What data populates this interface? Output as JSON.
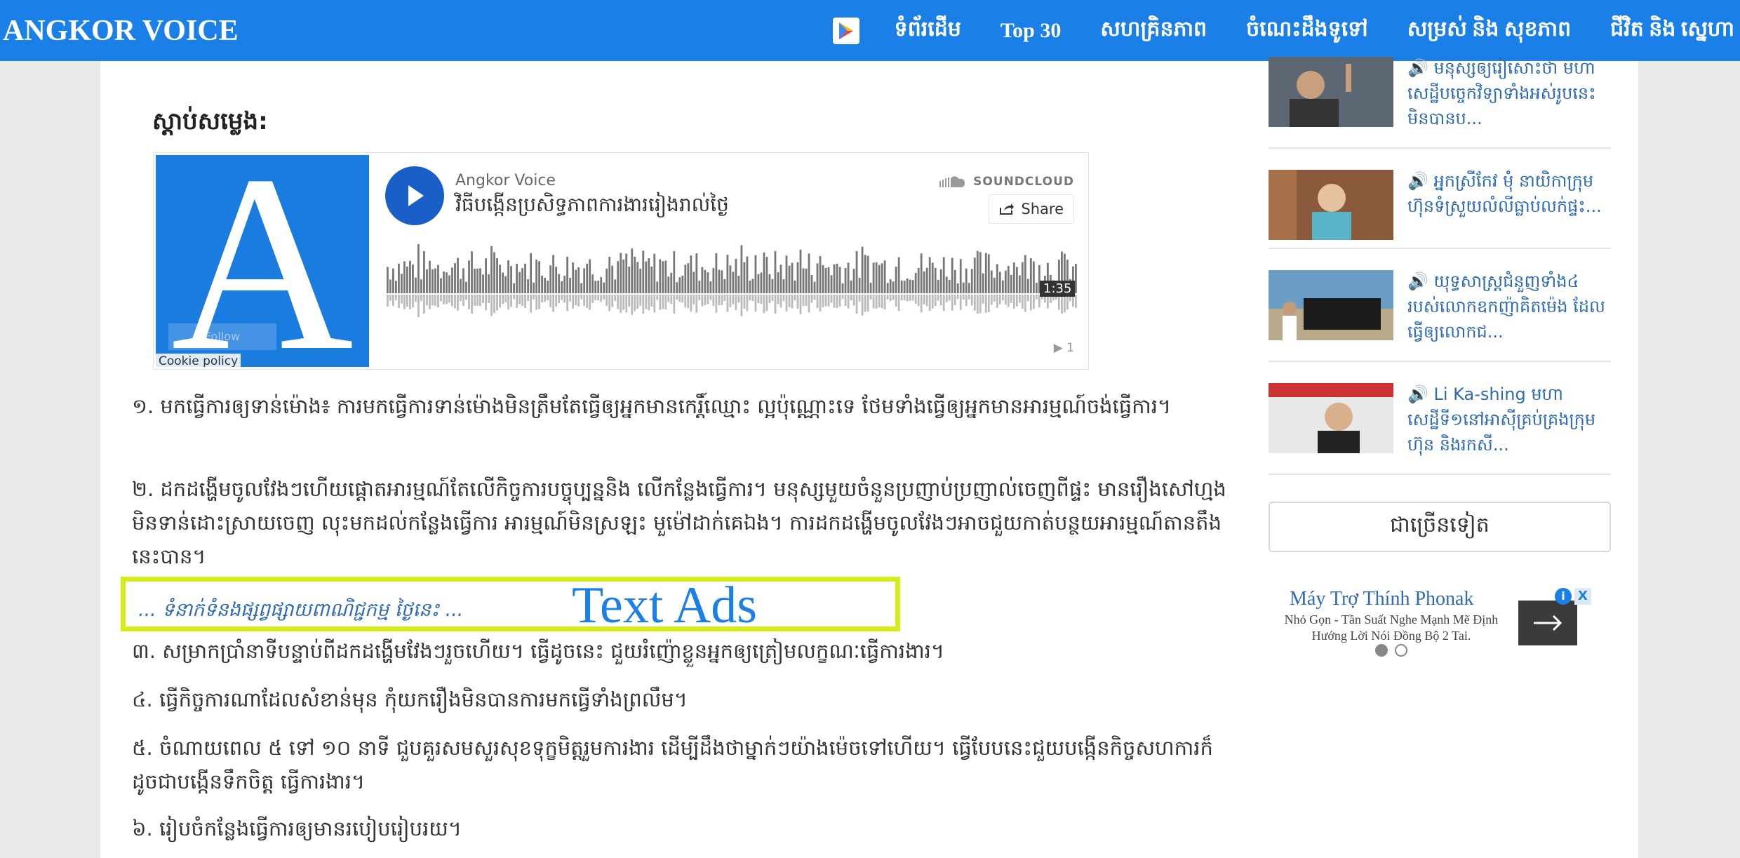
{
  "header": {
    "logo": "ANGKOR VOICE",
    "nav_items": [
      {
        "label": "ទំព័រដើម"
      },
      {
        "label": "Top 30"
      },
      {
        "label": "សហគ្រិនភាព"
      },
      {
        "label": "ចំណេះដឹងទូទៅ"
      },
      {
        "label": "សម្រស់ និង សុខភាព"
      },
      {
        "label": "ជីវិត និង ស្នេហា"
      }
    ],
    "play_store_icon": "google-play-icon"
  },
  "article": {
    "listen_label": "ស្តាប់សម្លេង:",
    "player": {
      "artist": "Angkor Voice",
      "track": "វិធីបង្កើនប្រសិទ្ធភាពការងាររៀងរាល់ថ្ងៃ",
      "brand": "SOUNDCLOUD",
      "share_label": "Share",
      "duration": "1:35",
      "plays": "1",
      "follow_label": "Follow",
      "cookie_label": "Cookie policy",
      "art_letter": "A"
    },
    "paragraphs": [
      "១. មកធ្វើការឲ្យទាន់ម៉ោង៖ ការមកធ្វើការទាន់ម៉ោងមិនត្រឹមតែធ្វើឲ្យអ្នកមានកេរ្តិ៍ឈ្មោះ ល្អប៉ុណ្ណោះទេ ថែមទាំងធ្វើឲ្យអ្នកមានអារម្មណ៍ចង់ធ្វើការ។",
      "២. ដកដង្ហើមចូលវែងៗហើយផ្តោតអារម្មណ៍តែលើកិច្ចការបច្ចុប្បន្ននិង លើកន្លែងធ្វើការ។ មនុស្សមួយចំនួនប្រញាប់ប្រញាល់ចេញពីផ្ទះ មានរឿងសៅហ្មងមិនទាន់ដោះស្រាយចេញ លុះមកដល់កន្លែងធ្វើការ អារម្មណ៍មិនស្រឡះ មួម៉ៅដាក់គេឯង។ ការដកដង្ហើមចូលវែងៗអាចជួយកាត់បន្ថយអារម្មណ៍តានតឹងនេះបាន។",
      "៣. សម្រាកប្រាំនាទីបន្ទាប់ពីដកដង្ហើមវែងៗរួចហើយ។ ធ្វើដូចនេះ ជួយរំញ៉ោខ្លួនអ្នកឲ្យត្រៀមលក្ខណៈធ្វើការងារ។",
      "៤. ធ្វើកិច្ចការណាដែលសំខាន់មុន កុំយករឿងមិនបានការមកធ្វើទាំងព្រលឹម។",
      "៥. ចំណាយពេល ៥ ទៅ ១០ នាទី ជួបគួរសមសួរសុខទុក្ខមិត្តរួមការងារ ដើម្បីដឹងថាម្នាក់ៗយ៉ាងម៉េចទៅហើយ។ ធ្វើបែបនេះជួយបង្កើនកិច្ចសហការក៏ដូចជាបង្កើនទឹកចិត្ត ធ្វើការងារ។",
      "៦. រៀបចំកន្លែងធ្វើការឲ្យមានរបៀបរៀបរយ។"
    ],
    "ad": {
      "link_text": "... ទំនាក់ទំនងផ្សព្វផ្សាយពាណិជ្ជកម្ម ថ្ងៃនេះ ...",
      "label": "Text Ads",
      "highlight_color": "#d6ec1b"
    }
  },
  "sidebar": {
    "items": [
      {
        "title": "🔊 មនុស្សឲ្យរៀសោះថា មហាសេដ្ឋីបច្ចេកវិទ្យាទាំងអស់រូបនេះ មិនបានប...",
        "thumb": "person-photo"
      },
      {
        "title": "🔊 អ្នកស្រីកែវ មុំ នាយិកាក្រុមហ៊ុនទំស្រួយលំលីធ្លាប់លក់ផ្ទះ...",
        "thumb": "person-photo"
      },
      {
        "title": "🔊 យុទ្ធសាស្ត្រជំនួញទាំង៤ របស់លោកឧកញ៉ាគិតម៉េង ដែលធ្វើឲ្យលោកជ...",
        "thumb": "car-photo"
      },
      {
        "title": "🔊 Li Ka-shing មហាសេដ្ឋីទី១នៅអាស៊ីគ្រប់គ្រងក្រុមហ៊ុន និងរកសី...",
        "thumb": "person-photo"
      }
    ],
    "more_label": "ជាច្រើនទៀត",
    "ad": {
      "title": "Máy Trợ Thính Phonak",
      "description": "Nhỏ Gọn - Tần Suất Nghe Mạnh Mẽ Định Hướng Lời Nói Đồng Bộ 2 Tai.",
      "info_label": "i",
      "close_label": "X"
    }
  },
  "colors": {
    "brand_blue": "#1a7fe6",
    "link_blue": "#2e6ab1"
  }
}
